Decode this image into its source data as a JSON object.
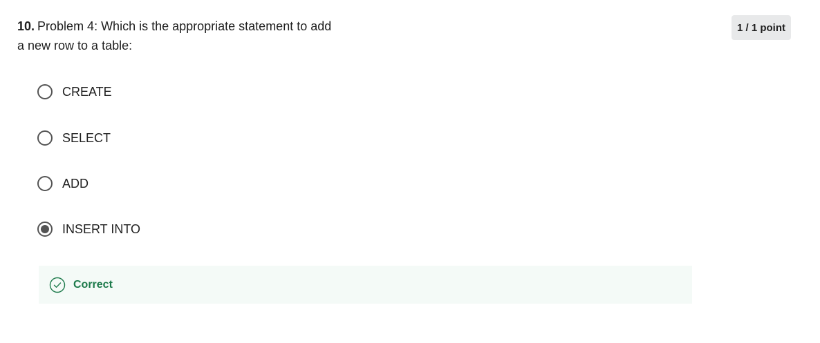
{
  "question": {
    "number": "10.",
    "text": "Problem 4: Which is the appropriate statement to add a new row to a table:"
  },
  "score": {
    "label": "1 / 1 point"
  },
  "options": [
    {
      "label": "CREATE",
      "selected": false
    },
    {
      "label": "SELECT",
      "selected": false
    },
    {
      "label": "ADD",
      "selected": false
    },
    {
      "label": "INSERT INTO",
      "selected": true
    }
  ],
  "feedback": {
    "status": "Correct",
    "icon": "check-circle-icon",
    "color": "#1d7a4b"
  },
  "colors": {
    "radio": "#545454",
    "badge_bg": "#e8e9ea",
    "feedback_bg": "#f4faf7"
  }
}
